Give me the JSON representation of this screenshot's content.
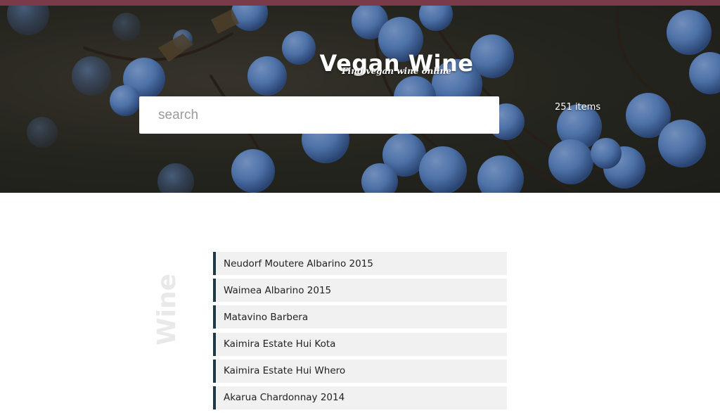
{
  "colors": {
    "top_strip": "#7b3a4a",
    "item_accent": "#1d3a45",
    "item_background": "#f1f1f1",
    "berry": "#5a86c8"
  },
  "header": {
    "title": "Vegan Wine",
    "subtitle": "Find vegan wine online"
  },
  "search": {
    "placeholder": "search",
    "value": ""
  },
  "results": {
    "count_label": "251 items"
  },
  "section": {
    "label": "Wine"
  },
  "wines": [
    {
      "name": "Neudorf Moutere Albarino 2015"
    },
    {
      "name": "Waimea Albarino 2015"
    },
    {
      "name": "Matavino Barbera"
    },
    {
      "name": "Kaimira Estate Hui Kota"
    },
    {
      "name": "Kaimira Estate Hui Whero"
    },
    {
      "name": "Akarua Chardonnay 2014"
    }
  ]
}
